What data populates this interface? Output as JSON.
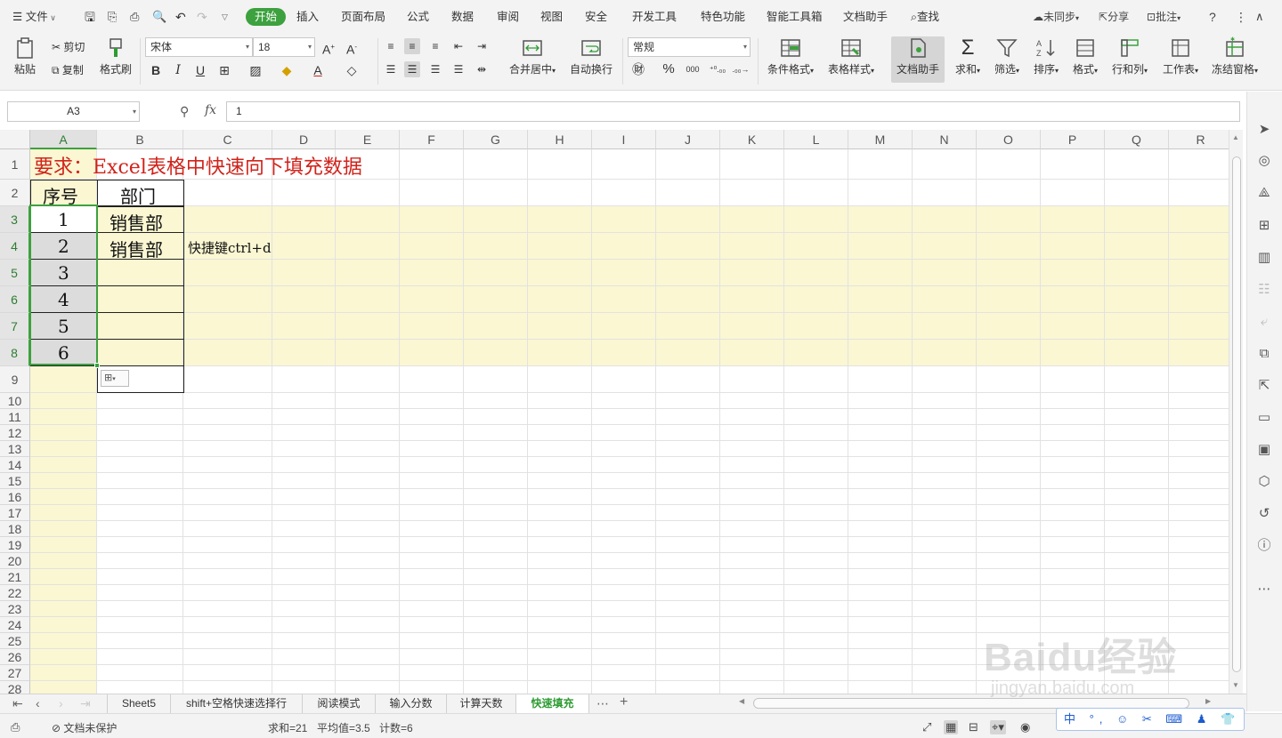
{
  "menu": {
    "file": "文件",
    "tabs": [
      "开始",
      "插入",
      "页面布局",
      "公式",
      "数据",
      "审阅",
      "视图",
      "安全",
      "开发工具",
      "特色功能",
      "智能工具箱",
      "文档助手"
    ],
    "search": "查找",
    "right": {
      "sync": "未同步",
      "share": "分享",
      "comment": "批注"
    }
  },
  "ribbon": {
    "paste": "粘贴",
    "cut": "剪切",
    "copy": "复制",
    "format_painter": "格式刷",
    "font_name": "宋体",
    "font_size": "18",
    "bold": "B",
    "italic": "I",
    "underline": "U",
    "merge_center": "合并居中",
    "wrap_text": "自动换行",
    "number_format": "常规",
    "percent": "%",
    "thousands": "000",
    "conditional_format": "条件格式",
    "table_style": "表格样式",
    "doc_assistant": "文档助手",
    "sum": "求和",
    "filter": "筛选",
    "sort": "排序",
    "format": "格式",
    "row_col": "行和列",
    "worksheet": "工作表",
    "freeze": "冻结窗格"
  },
  "formula_bar": {
    "name_box": "A3",
    "fx": "fx",
    "value": "1"
  },
  "columns": [
    "A",
    "B",
    "C",
    "D",
    "E",
    "F",
    "G",
    "H",
    "I",
    "J",
    "K",
    "L",
    "M",
    "N",
    "O",
    "P",
    "Q",
    "R"
  ],
  "rows": [
    "1",
    "2",
    "3",
    "4",
    "5",
    "6",
    "7",
    "8",
    "9",
    "10",
    "11",
    "12",
    "13",
    "14",
    "15",
    "16",
    "17",
    "18",
    "19",
    "20",
    "21",
    "22",
    "23",
    "24",
    "25",
    "26",
    "27",
    "28"
  ],
  "cells": {
    "title": "要求：Excel表格中快速向下填充数据",
    "header_a": "序号",
    "header_b": "部门",
    "seq": [
      "1",
      "2",
      "3",
      "4",
      "5",
      "6"
    ],
    "dept": [
      "销售部",
      "销售部"
    ],
    "note": "快捷键ctrl+d"
  },
  "sheet_tabs": [
    "Sheet5",
    "shift+空格快速选择行",
    "阅读模式",
    "输入分数",
    "计算天数",
    "快速填充"
  ],
  "active_sheet": "快速填充",
  "status": {
    "protect": "文档未保护",
    "sum": "求和=21",
    "average": "平均值=3.5",
    "count": "计数=6"
  },
  "ime": "中 °, ☺ ✂ ⌨ ♟ 👕 ⚙",
  "watermark": {
    "main": "Baidu经验",
    "sub": "jingyan.baidu.com"
  },
  "colors": {
    "accent": "#3ca13e",
    "title_red": "#d0231b",
    "highlight": "#faf7d2"
  }
}
